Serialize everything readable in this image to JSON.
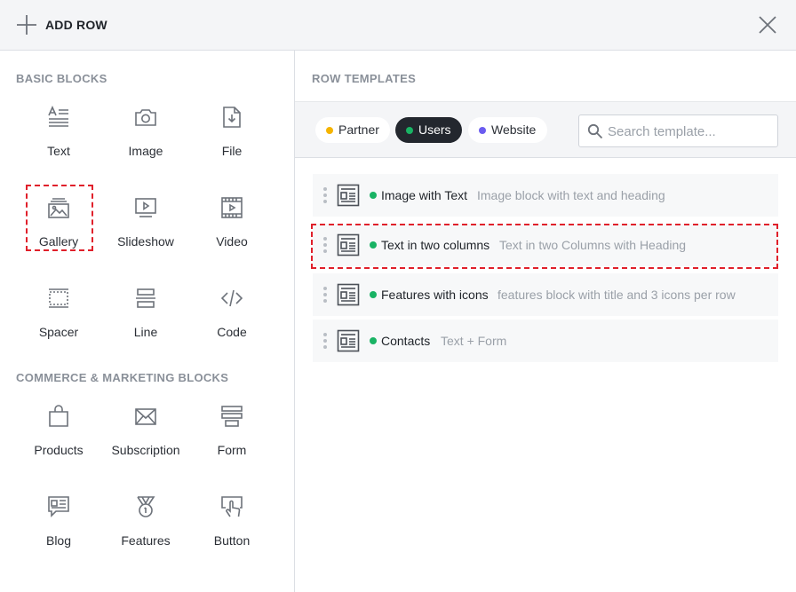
{
  "header": {
    "title": "ADD ROW",
    "add_icon": "plus-icon",
    "close_icon": "close-icon"
  },
  "left": {
    "basic_title": "BASIC BLOCKS",
    "basic_blocks": [
      {
        "label": "Text",
        "icon": "text-icon"
      },
      {
        "label": "Image",
        "icon": "camera-icon"
      },
      {
        "label": "File",
        "icon": "file-download-icon"
      },
      {
        "label": "Gallery",
        "icon": "gallery-icon"
      },
      {
        "label": "Slideshow",
        "icon": "slideshow-icon"
      },
      {
        "label": "Video",
        "icon": "video-icon"
      },
      {
        "label": "Spacer",
        "icon": "spacer-icon"
      },
      {
        "label": "Line",
        "icon": "line-icon"
      },
      {
        "label": "Code",
        "icon": "code-icon"
      }
    ],
    "commerce_title": "COMMERCE & MARKETING BLOCKS",
    "commerce_blocks": [
      {
        "label": "Products",
        "icon": "shopping-bag-icon"
      },
      {
        "label": "Subscription",
        "icon": "envelope-icon"
      },
      {
        "label": "Form",
        "icon": "form-icon"
      },
      {
        "label": "Blog",
        "icon": "blog-icon"
      },
      {
        "label": "Features",
        "icon": "medal-icon"
      },
      {
        "label": "Button",
        "icon": "pointer-hand-icon"
      }
    ]
  },
  "right": {
    "title": "ROW TEMPLATES",
    "filters": [
      {
        "label": "Partner",
        "dot_color": "#f5b400",
        "active": false
      },
      {
        "label": "Users",
        "dot_color": "#19b364",
        "active": true
      },
      {
        "label": "Website",
        "dot_color": "#6b5cf0",
        "active": false
      }
    ],
    "search_placeholder": "Search template...",
    "templates": [
      {
        "name": "Image with Text",
        "description": "Image block with text and heading"
      },
      {
        "name": "Text in two columns",
        "description": "Text in two Columns with Heading"
      },
      {
        "name": "Features with icons",
        "description": "features block with title and 3 icons per row"
      },
      {
        "name": "Contacts",
        "description": "Text + Form"
      }
    ]
  },
  "colors": {
    "accent_dark": "#23272e",
    "status_green": "#19b364",
    "highlight_red": "#e0202b"
  }
}
